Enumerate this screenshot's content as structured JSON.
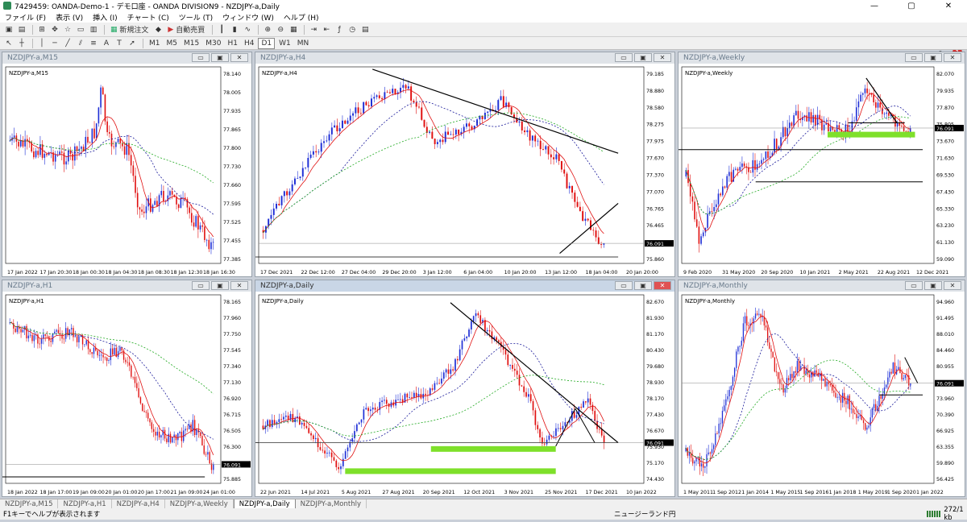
{
  "window": {
    "title": "7429459: OANDA-Demo-1 - デモ口座 - OANDA DIVISION9 - NZDJPY-a,Daily",
    "controls": [
      "—",
      "▢",
      "✕"
    ]
  },
  "menu": [
    "ファイル (F)",
    "表示 (V)",
    "挿入 (I)",
    "チャート (C)",
    "ツール (T)",
    "ウィンドウ (W)",
    "ヘルプ (H)"
  ],
  "toolbar": {
    "new_order": "新規注文",
    "auto_trade": "自動売買",
    "notification_count": "1"
  },
  "timeframes": [
    "M1",
    "M5",
    "M15",
    "M30",
    "H1",
    "H4",
    "D1",
    "W1",
    "MN"
  ],
  "charts": {
    "m15": {
      "title": "NZDJPY-a,M15",
      "label": "NZDJPY-a,M15",
      "yticks": [
        "78.140",
        "78.005",
        "77.935",
        "77.865",
        "77.800",
        "77.730",
        "77.660",
        "77.595",
        "77.525",
        "77.455",
        "77.385"
      ],
      "xticks": [
        "17 Jan 2022",
        "17 Jan 20:30",
        "18 Jan 00:30",
        "18 Jan 04:30",
        "18 Jan 08:30",
        "18 Jan 12:30",
        "18 Jan 16:30"
      ]
    },
    "h4": {
      "title": "NZDJPY-a,H4",
      "label": "NZDJPY-a,H4",
      "yticks": [
        "79.185",
        "78.880",
        "78.580",
        "78.275",
        "77.975",
        "77.670",
        "77.370",
        "77.070",
        "76.765",
        "76.465",
        "76.165",
        "75.860"
      ],
      "xticks": [
        "17 Dec 2021",
        "22 Dec 12:00",
        "27 Dec 04:00",
        "29 Dec 20:00",
        "3 Jan 12:00",
        "6 Jan 04:00",
        "10 Jan 20:00",
        "13 Jan 12:00",
        "18 Jan 04:00",
        "20 Jan 20:00"
      ],
      "price": "76.091"
    },
    "weekly": {
      "title": "NZDJPY-a,Weekly",
      "label": "NZDJPY-a,Weekly",
      "yticks": [
        "82.070",
        "79.935",
        "77.870",
        "75.805",
        "73.670",
        "71.630",
        "69.530",
        "67.430",
        "65.330",
        "63.230",
        "61.130",
        "59.090"
      ],
      "xticks": [
        "9 Feb 2020",
        "31 May 2020",
        "20 Sep 2020",
        "10 Jan 2021",
        "2 May 2021",
        "22 Aug 2021",
        "12 Dec 2021"
      ],
      "price": "76.091"
    },
    "h1": {
      "title": "NZDJPY-a,H1",
      "label": "NZDJPY-a,H1",
      "yticks": [
        "78.165",
        "77.960",
        "77.750",
        "77.545",
        "77.340",
        "77.130",
        "76.920",
        "76.715",
        "76.505",
        "76.300",
        "76.091",
        "75.885"
      ],
      "xticks": [
        "18 Jan 2022",
        "18 Jan 17:00",
        "19 Jan 09:00",
        "20 Jan 01:00",
        "20 Jan 17:00",
        "21 Jan 09:00",
        "24 Jan 01:00"
      ],
      "price": "76.091"
    },
    "daily": {
      "title": "NZDJPY-a,Daily",
      "label": "NZDJPY-a,Daily",
      "yticks": [
        "82.670",
        "81.930",
        "81.170",
        "80.430",
        "79.680",
        "78.930",
        "78.170",
        "77.430",
        "76.670",
        "75.930",
        "75.170",
        "74.430"
      ],
      "xticks": [
        "22 Jun 2021",
        "14 Jul 2021",
        "5 Aug 2021",
        "27 Aug 2021",
        "20 Sep 2021",
        "12 Oct 2021",
        "3 Nov 2021",
        "25 Nov 2021",
        "17 Dec 2021",
        "10 Jan 2022"
      ],
      "price": "76.091"
    },
    "monthly": {
      "title": "NZDJPY-a,Monthly",
      "label": "NZDJPY-a,Monthly",
      "yticks": [
        "94.960",
        "91.495",
        "88.010",
        "84.460",
        "80.955",
        "77.425",
        "73.960",
        "70.390",
        "66.925",
        "63.355",
        "59.890",
        "56.425"
      ],
      "xticks": [
        "1 May 2011",
        "1 Sep 2012",
        "1 Jan 2014",
        "1 May 2015",
        "1 Sep 2016",
        "1 Jan 2018",
        "1 May 2019",
        "1 Sep 2020",
        "1 Jan 2022"
      ],
      "price": "76.091"
    }
  },
  "tabs": [
    "NZDJPY-a,M15",
    "NZDJPY-a,H1",
    "NZDJPY-a,H4",
    "NZDJPY-a,Weekly",
    "NZDJPY-a,Daily",
    "NZDJPY-a,Monthly"
  ],
  "status": {
    "help": "F1キーでヘルプが表示されます",
    "currency": "ニュージーランド円",
    "traffic": "272/1 kb"
  },
  "colors": {
    "bull": "#1f2fd6",
    "bear": "#e01010",
    "ma_fast": "#e01010",
    "ma_mid": "#1a1a9a",
    "ma_slow": "#22aa22",
    "zone": "#7ee02a"
  }
}
